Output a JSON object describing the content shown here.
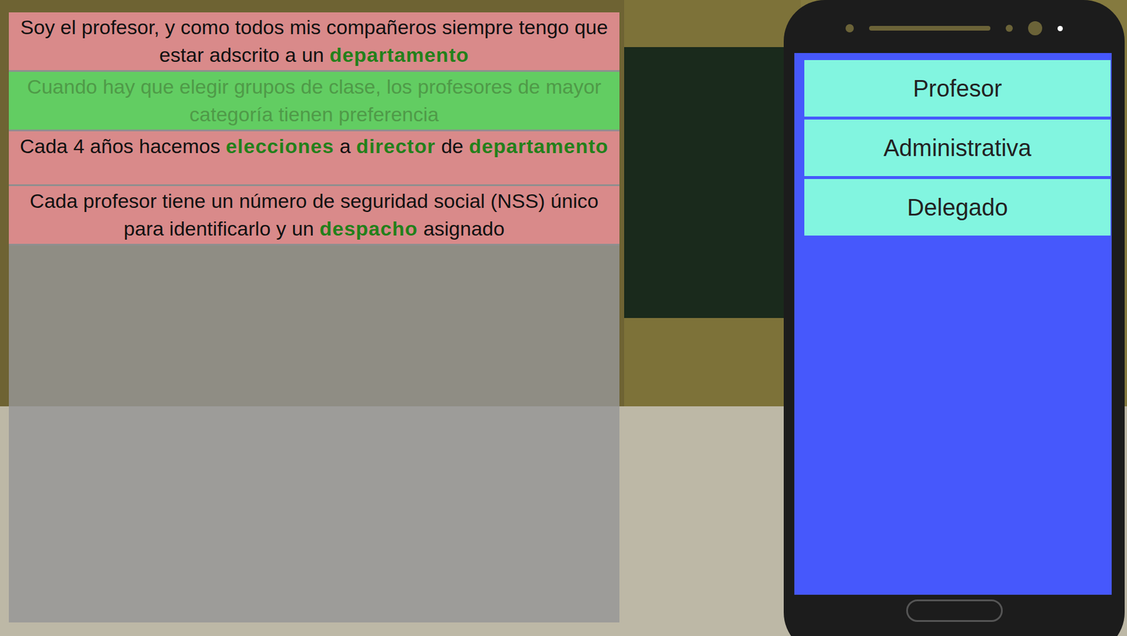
{
  "statements": [
    {
      "selected": false,
      "segments": [
        {
          "text": "Soy el profesor, y como todos mis compañeros siempre tengo que estar adscrito a un ",
          "highlight": false
        },
        {
          "text": "departamento",
          "highlight": true
        }
      ]
    },
    {
      "selected": true,
      "segments": [
        {
          "text": "Cuando hay que elegir grupos de clase, los profesores de mayor categoría tienen preferencia",
          "highlight": false
        }
      ]
    },
    {
      "selected": false,
      "segments": [
        {
          "text": "Cada 4 años hacemos ",
          "highlight": false
        },
        {
          "text": "elecciones",
          "highlight": true
        },
        {
          "text": " a ",
          "highlight": false
        },
        {
          "text": "director",
          "highlight": true
        },
        {
          "text": " de ",
          "highlight": false
        },
        {
          "text": "departamento",
          "highlight": true
        }
      ]
    },
    {
      "selected": false,
      "segments": [
        {
          "text": "Cada profesor tiene un número de seguridad social (NSS) único para identificarlo y un ",
          "highlight": false
        },
        {
          "text": "despacho",
          "highlight": true
        },
        {
          "text": " asignado",
          "highlight": false
        }
      ]
    }
  ],
  "phone": {
    "options": [
      "Profesor",
      "Administrativa",
      "Delegado"
    ]
  }
}
